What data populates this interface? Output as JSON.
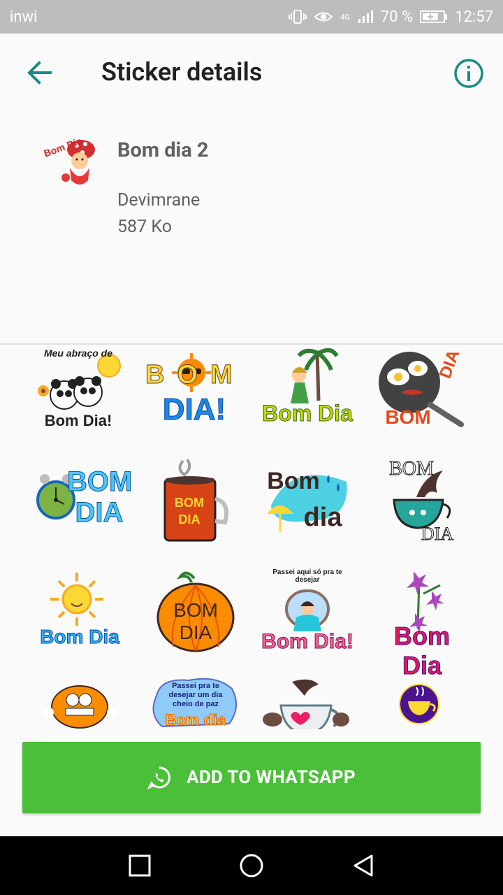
{
  "status_bar": {
    "carrier": "inwi",
    "network": "4G",
    "battery": "70 %",
    "time": "12:57"
  },
  "app_bar": {
    "title": "Sticker details",
    "back_icon": "arrow-back-icon",
    "info_icon": "info-icon"
  },
  "pack": {
    "name": "Bom dia 2",
    "author": "Devimrane",
    "size": "587 Ko",
    "tray_icon_text": "Bom Dia"
  },
  "stickers": [
    {
      "top_text": "Meu abraço de",
      "bottom_text": "Bom Dia!",
      "icon": "pandas-sun"
    },
    {
      "top_text": "BOM",
      "bottom_text": "DIA!",
      "icon": "sun-sunglasses"
    },
    {
      "top_text": "",
      "bottom_text": "Bom Dia",
      "icon": "girl-palm-tree"
    },
    {
      "top_text": "DIA",
      "bottom_text": "BOM",
      "icon": "frying-pan-eggs"
    },
    {
      "top_text": "BOM",
      "bottom_text": "DIA",
      "icon": "alarm-clock"
    },
    {
      "top_text": "BOM",
      "bottom_text": "DIA",
      "icon": "red-mug"
    },
    {
      "top_text": "Bom",
      "bottom_text": "dia",
      "icon": "umbrella-rain"
    },
    {
      "top_text": "BOM",
      "bottom_text": "DIA",
      "icon": "coffee-cup-splash"
    },
    {
      "top_text": "",
      "bottom_text": "Bom Dia",
      "icon": "sun"
    },
    {
      "top_text": "BOM",
      "bottom_text": "DIA",
      "icon": "pumpkin"
    },
    {
      "top_text": "Passei aqui só pra te desejar",
      "bottom_text": "Bom Dia!",
      "icon": "girl-window"
    },
    {
      "top_text": "",
      "bottom_text": "Bom Dia",
      "icon": "purple-flowers"
    },
    {
      "top_text": "",
      "bottom_text": "",
      "icon": "garfield"
    },
    {
      "top_text": "Passei pra te desejar um dia cheio de paz",
      "bottom_text": "Bom dia",
      "icon": "speech-cloud"
    },
    {
      "top_text": "",
      "bottom_text": "",
      "icon": "coffee-heart-cup"
    },
    {
      "top_text": "",
      "bottom_text": "",
      "icon": "coffee-cup-purple-circle"
    }
  ],
  "add_button": {
    "label": "ADD TO WHATSAPP",
    "icon": "whatsapp-icon"
  },
  "nav": {
    "recents_icon": "recents-square-icon",
    "home_icon": "home-circle-icon",
    "back_icon": "back-triangle-icon"
  },
  "colors": {
    "accent": "#1a8a84",
    "button": "#4bbf39",
    "status_bar": "#bdbdbd"
  }
}
